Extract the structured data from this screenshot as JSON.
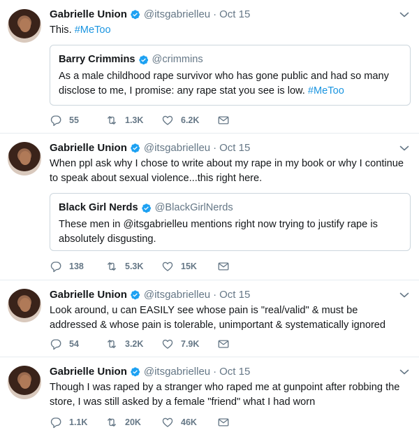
{
  "colors": {
    "link": "#1b95e0",
    "muted": "#657786",
    "verified": "#1da1f2",
    "border": "#e6ecf0"
  },
  "icons": [
    "reply-icon",
    "retweet-icon",
    "like-icon",
    "message-icon",
    "verified-icon",
    "chevron-down-icon"
  ],
  "tweets": [
    {
      "name": "Gabrielle Union",
      "handle": "@itsgabrielleu",
      "separator": "·",
      "time": "Oct 15",
      "text_prefix": "This. ",
      "hashtag": "#MeToo",
      "quote": {
        "name": "Barry Crimmins",
        "handle": "@crimmins",
        "text": "As a male childhood rape survivor who has gone public and had so many disclose to me, I promise: any rape stat you see is low.  ",
        "hashtag": "#MeToo"
      },
      "replies": "55",
      "retweets": "1.3K",
      "likes": "6.2K"
    },
    {
      "name": "Gabrielle Union",
      "handle": "@itsgabrielleu",
      "separator": "·",
      "time": "Oct 15",
      "text": "When ppl ask why I chose to write about my rape in my book or why I continue to speak about sexual violence...this right here.",
      "quote": {
        "name": "Black Girl Nerds",
        "handle": "@BlackGirlNerds",
        "text": "These men in @itsgabrielleu mentions right now trying to justify rape is absolutely disgusting."
      },
      "replies": "138",
      "retweets": "5.3K",
      "likes": "15K"
    },
    {
      "name": "Gabrielle Union",
      "handle": "@itsgabrielleu",
      "separator": "·",
      "time": "Oct 15",
      "text": "Look around, u can EASILY see whose pain is \"real/valid\" & must be addressed & whose pain is tolerable, unimportant & systematically ignored",
      "replies": "54",
      "retweets": "3.2K",
      "likes": "7.9K"
    },
    {
      "name": "Gabrielle Union",
      "handle": "@itsgabrielleu",
      "separator": "·",
      "time": "Oct 15",
      "text": "Though I was raped by a stranger who raped me at gunpoint after robbing the store, I was still asked by a female \"friend\" what I had worn",
      "replies": "1.1K",
      "retweets": "20K",
      "likes": "46K"
    }
  ]
}
